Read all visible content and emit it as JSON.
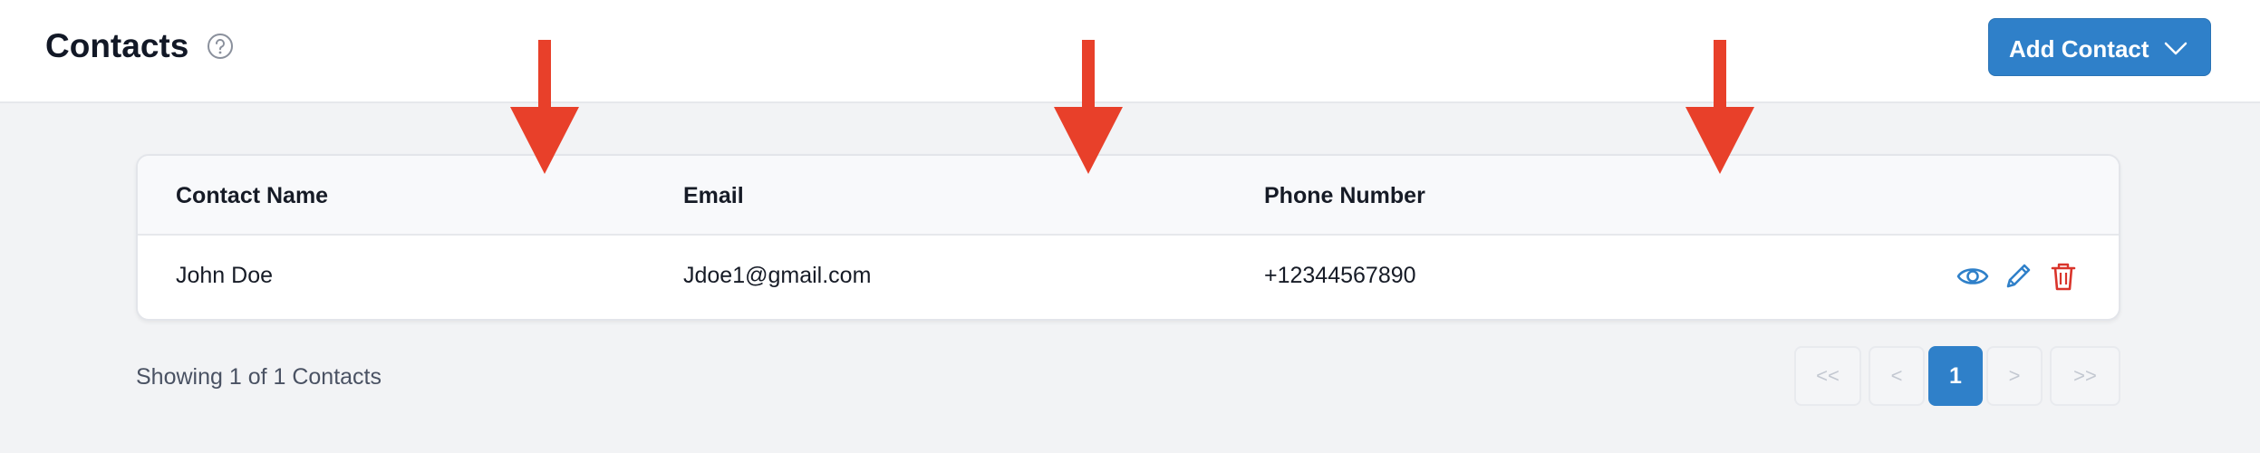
{
  "header": {
    "title": "Contacts",
    "add_button_label": "Add Contact"
  },
  "table": {
    "columns": [
      "Contact Name",
      "Email",
      "Phone Number"
    ],
    "rows": [
      {
        "name": "John Doe",
        "email": "Jdoe1@gmail.com",
        "phone": "+12344567890"
      }
    ]
  },
  "footer": {
    "showing_text": "Showing 1 of 1 Contacts"
  },
  "pagination": {
    "first": "<<",
    "prev": "<",
    "current": "1",
    "next": ">",
    "last": ">>"
  },
  "icons": {
    "help": "help-circle-icon",
    "dropdown": "chevron-down-icon",
    "view": "eye-icon",
    "edit": "pencil-icon",
    "delete": "trash-icon",
    "annotation": "down-arrow-annotation"
  },
  "colors": {
    "accent": "#2f80c9",
    "delete": "#d9342b",
    "annotation_arrow": "#e8402a"
  }
}
